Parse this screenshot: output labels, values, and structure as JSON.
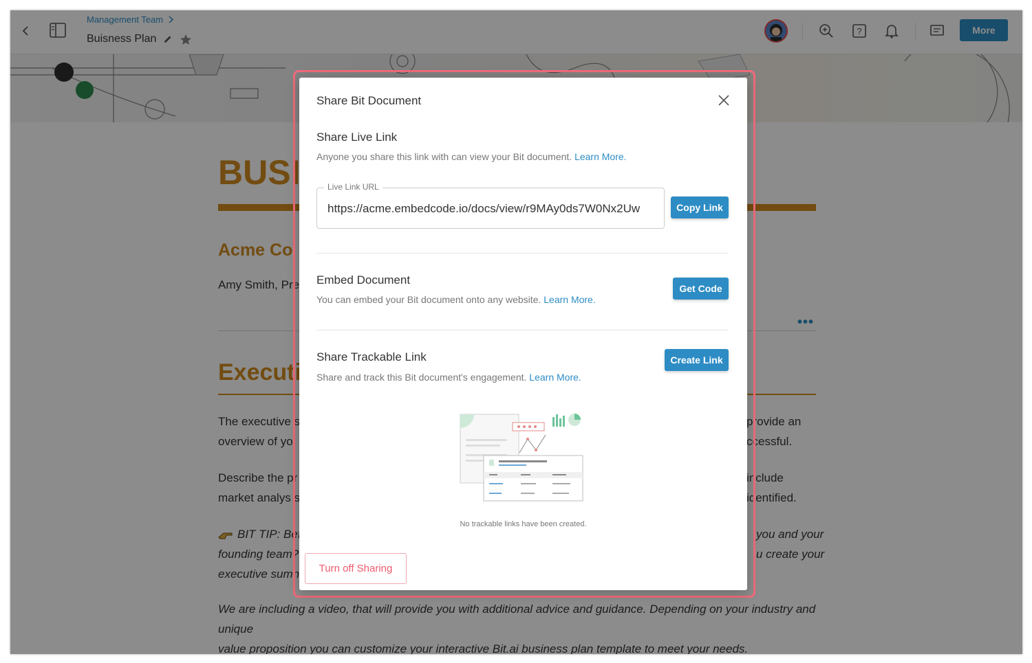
{
  "header": {
    "breadcrumb": "Management Team",
    "doc_title": "Buisness Plan",
    "more_label": "More"
  },
  "document": {
    "big_title": "BUSI",
    "company": "Acme Co",
    "author": "Amy Smith, Pre",
    "exec_title": "Executi",
    "para1_line1_left": "The executive s",
    "para1_line1_right": "provide an",
    "para1_line2_left": "overview of yo",
    "para1_line2_right": "ccessful.",
    "para2_line1_left": "Describe the pr",
    "para2_line1_right": "include",
    "para2_line2_left": "market analys s",
    "para2_line2_right": "identified.",
    "tip_line1_left": "BIT TIP: Befo",
    "tip_line1_right": "you and your",
    "tip_line2_left": "founding team? I",
    "tip_line2_right": "u create your",
    "tip_line3_left": "executive sumn",
    "video_line1": "We are including a video, that will provide you with additional advice and guidance. Depending on your industry and unique",
    "video_line2_before": "value proposition you can customize your interactive ",
    "video_line2_link": "Bit.ai",
    "video_line2_after": " business plan template to meet your needs."
  },
  "modal": {
    "title": "Share Bit Document",
    "live_link": {
      "title": "Share Live Link",
      "desc": "Anyone you share this link with can view your Bit document.",
      "learn_more": "Learn More.",
      "field_label": "Live Link URL",
      "url": "https://acme.embedcode.io/docs/view/r9MAy0ds7W0Nx2Uw",
      "copy_label": "Copy Link"
    },
    "embed": {
      "title": "Embed Document",
      "desc": "You can embed your Bit document onto any website.",
      "learn_more": "Learn More.",
      "button": "Get Code"
    },
    "trackable": {
      "title": "Share Trackable Link",
      "desc": "Share and track this Bit document's engagement.",
      "learn_more": "Learn More.",
      "button": "Create Link",
      "empty_note": "No trackable links have been created."
    },
    "turn_off_label": "Turn off Sharing"
  },
  "colors": {
    "accent": "#2d8cc4",
    "doc_orange": "#d08a1f",
    "highlight": "#f06b7a",
    "danger_text": "#ee5b6c"
  }
}
